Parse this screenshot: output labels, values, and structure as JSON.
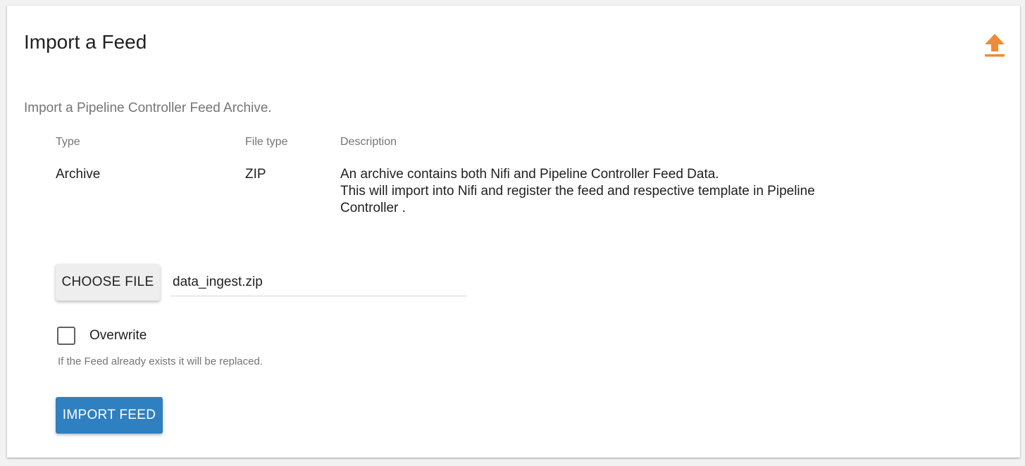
{
  "page": {
    "title": "Import a Feed",
    "subtitle": "Import a Pipeline Controller Feed Archive.",
    "upload_icon": "upload-icon",
    "accent_color": "#ee8b3a"
  },
  "table": {
    "headers": {
      "type": "Type",
      "file_type": "File type",
      "description": "Description"
    },
    "row": {
      "type": "Archive",
      "file_type": "ZIP",
      "description_line1": "An archive contains both Nifi and Pipeline Controller Feed Data.",
      "description_line2": "This will import into Nifi and register the feed and respective template in Pipeline Controller ."
    }
  },
  "file_picker": {
    "button_label": "CHOOSE FILE",
    "file_name": "data_ingest.zip"
  },
  "overwrite": {
    "label": "Overwrite",
    "checked": false,
    "hint": "If the Feed already exists it will be replaced."
  },
  "actions": {
    "import_label": "IMPORT FEED",
    "import_color": "#2f80c0"
  }
}
